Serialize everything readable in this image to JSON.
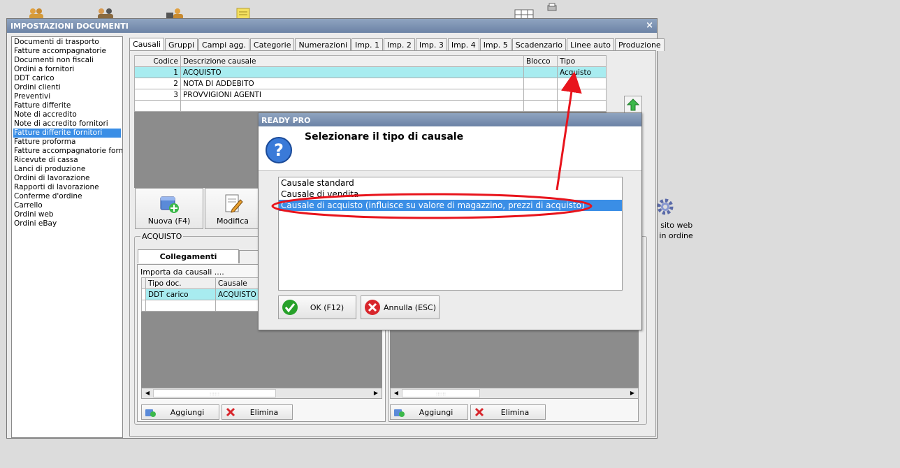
{
  "desktop": {
    "right_labels": [
      "na sito web",
      "rti in ordine"
    ]
  },
  "window": {
    "title": "IMPOSTAZIONI DOCUMENTI",
    "close_glyph": "×",
    "doc_list": [
      "Documenti di trasporto",
      "Fatture accompagnatorie",
      "Documenti non fiscali",
      "Ordini a fornitori",
      "DDT carico",
      "Ordini clienti",
      "Preventivi",
      "Fatture differite",
      "Note di accredito",
      "Note di accredito fornitori",
      "Fatture differite fornitori",
      "Fatture proforma",
      "Fatture accompagnatorie fornito",
      "Ricevute di cassa",
      "Lanci di produzione",
      "Ordini di lavorazione",
      "Rapporti di lavorazione",
      "Conferme d'ordine",
      "Carrello",
      "Ordini web",
      "Ordini eBay"
    ],
    "selected_doc": "Fatture differite fornitori",
    "tabs": [
      "Causali",
      "Gruppi",
      "Campi agg.",
      "Categorie",
      "Numerazioni",
      "Imp. 1",
      "Imp. 2",
      "Imp. 3",
      "Imp. 4",
      "Imp. 5",
      "Scadenzario",
      "Linee auto",
      "Produzione"
    ],
    "active_tab": "Causali",
    "causali_table": {
      "columns": [
        "Codice",
        "Descrizione causale",
        "Blocco",
        "Tipo"
      ],
      "rows": [
        {
          "codice": "1",
          "descrizione": "ACQUISTO",
          "blocco": "",
          "tipo": "Acquisto"
        },
        {
          "codice": "2",
          "descrizione": "NOTA DI ADDEBITO",
          "blocco": "",
          "tipo": ""
        },
        {
          "codice": "3",
          "descrizione": "PROVVIGIONI AGENTI",
          "blocco": "",
          "tipo": ""
        }
      ]
    },
    "buttons": {
      "nuova": "Nuova (F4)",
      "modifica": "Modifica"
    },
    "group_title": "ACQUISTO",
    "subtab_active": "Collegamenti",
    "left_sub": {
      "label": "Importa da causali ....",
      "columns": [
        "Tipo doc.",
        "Causale"
      ],
      "rows": [
        {
          "tipo": "DDT carico",
          "causale": "ACQUISTO"
        }
      ],
      "add": "Aggiungi",
      "delete": "Elimina"
    },
    "right_sub": {
      "add": "Aggiungi",
      "delete": "Elimina"
    },
    "scroll_grip": "::::::"
  },
  "dialog": {
    "title": "READY PRO",
    "message": "Selezionare il tipo di causale",
    "options": [
      "Causale standard",
      "Causale di vendita",
      "Causale di acquisto (influisce su valore di magazzino, prezzi di acquisto)"
    ],
    "selected_index": 2,
    "ok": "OK (F12)",
    "cancel": "Annulla (ESC)"
  },
  "colors": {
    "selection": "#3a8ee6",
    "row_highlight": "#a8ecf0",
    "annotation": "#e8141c",
    "ok_green": "#27a12a",
    "cancel_red": "#d8262c"
  }
}
